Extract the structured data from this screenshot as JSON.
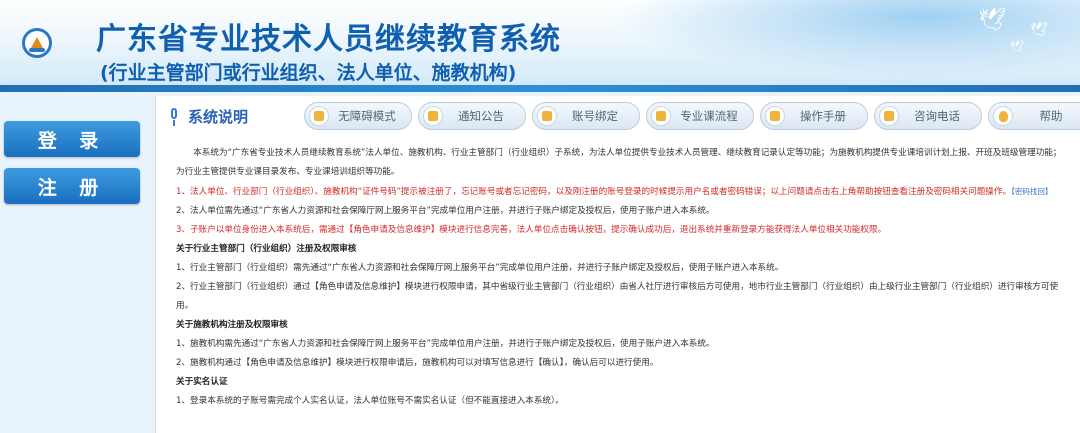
{
  "header": {
    "title": "广东省专业技术人员继续教育系统",
    "subtitle": "(行业主管部门或行业组织、法人单位、施教机构)"
  },
  "nav": {
    "login": "登 录",
    "register": "注 册"
  },
  "panel": {
    "title": "系统说明"
  },
  "toolbar": [
    {
      "label": "无障碍模式"
    },
    {
      "label": "通知公告"
    },
    {
      "label": "账号绑定"
    },
    {
      "label": "专业课流程"
    },
    {
      "label": "操作手册"
    },
    {
      "label": "咨询电话"
    },
    {
      "label": "帮助"
    }
  ],
  "content": {
    "intro": "本系统为“广东省专业技术人员继续教育系统”法人单位、施教机构、行业主管部门（行业组织）子系统，为法人单位提供专业技术人员管理、继续教育记录认定等功能；为施教机构提供专业课培训计划上报、开班及班级管理功能；为行业主管提供专业课目录发布、专业课培训组织等功能。",
    "item1": "1、法人单位、行业部门（行业组织）、施教机构“证件号码”提示被注册了，忘记账号或者忘记密码，以及刚注册的账号登录的时候提示用户名或者密码错误；以上问题请点击右上角帮助按钮查看注册及密码相关问题操作。",
    "item1_link": "【密码找回】",
    "item2": "2、法人单位需先通过“广东省人力资源和社会保障厅网上服务平台”完成单位用户注册，并进行子账户绑定及授权后，使用子账户进入本系统。",
    "item3": "3、子账户以单位身份进入本系统后，需通过【角色申请及信息维护】模块进行信息完善，法人单位点击确认按钮，提示确认成功后，退出系统并重新登录方能获得法人单位相关功能权限。",
    "sec1_title": "关于行业主管部门（行业组织）注册及权限审核",
    "sec1_item1": "1、行业主管部门（行业组织）需先通过“广东省人力资源和社会保障厅网上服务平台”完成单位用户注册，并进行子账户绑定及授权后，使用子账户进入本系统。",
    "sec1_item2": "2、行业主管部门（行业组织）通过【角色申请及信息维护】模块进行权限申请，其中省级行业主管部门（行业组织）由省人社厅进行审核后方可使用，地市行业主管部门（行业组织）由上级行业主管部门（行业组织）进行审核方可使用。",
    "sec2_title": "关于施教机构注册及权限审核",
    "sec2_item1": "1、施教机构需先通过“广东省人力资源和社会保障厅网上服务平台”完成单位用户注册，并进行子账户绑定及授权后，使用子账户进入本系统。",
    "sec2_item2": "2、施教机构通过【角色申请及信息维护】模块进行权限申请后，施教机构可以对填写信息进行【确认】，确认后可以进行使用。",
    "sec3_title": "关于实名认证",
    "sec3_item1": "1、登录本系统的子账号需完成个人实名认证，法人单位账号不需实名认证（但不能直接进入本系统）。"
  },
  "colors": {
    "title_blue": "#1160b0",
    "nav_blue": "#1a6fc0",
    "warning_red": "#d42a2a"
  },
  "icons": [
    "logo-emblem",
    "microphone-icon",
    "dove-icon",
    "bulb-icon"
  ]
}
